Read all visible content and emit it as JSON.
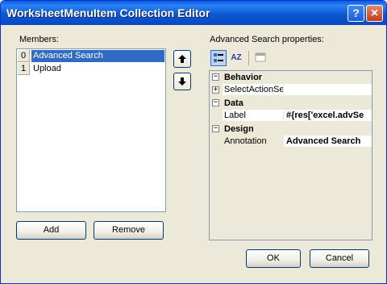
{
  "window": {
    "title": "WorksheetMenuItem Collection Editor",
    "help_glyph": "?",
    "close_glyph": "×"
  },
  "members": {
    "label": "Members:",
    "items": [
      {
        "index": "0",
        "label": "Advanced Search",
        "selected": true
      },
      {
        "index": "1",
        "label": "Upload",
        "selected": false
      }
    ],
    "add_label": "Add",
    "remove_label": "Remove",
    "move_up_icon": "arrow-up-icon",
    "move_down_icon": "arrow-down-icon"
  },
  "properties": {
    "label": "Advanced Search properties:",
    "toolbar": {
      "categorized_icon": "categorized-icon",
      "alphabetical_label": "AZ",
      "property_pages_icon": "property-pages-icon"
    },
    "categories": [
      {
        "name": "Behavior",
        "expanded": false,
        "props": [
          {
            "name": "SelectActionSe",
            "value": "",
            "expandable": true,
            "bold": false
          }
        ]
      },
      {
        "name": "Data",
        "expanded": true,
        "props": [
          {
            "name": "Label",
            "value": "#{res['excel.advSe",
            "expandable": false,
            "bold": true
          }
        ]
      },
      {
        "name": "Design",
        "expanded": true,
        "props": [
          {
            "name": "Annotation",
            "value": "Advanced Search",
            "expandable": false,
            "bold": true,
            "selected": true
          }
        ]
      }
    ]
  },
  "footer": {
    "ok_label": "OK",
    "cancel_label": "Cancel"
  }
}
